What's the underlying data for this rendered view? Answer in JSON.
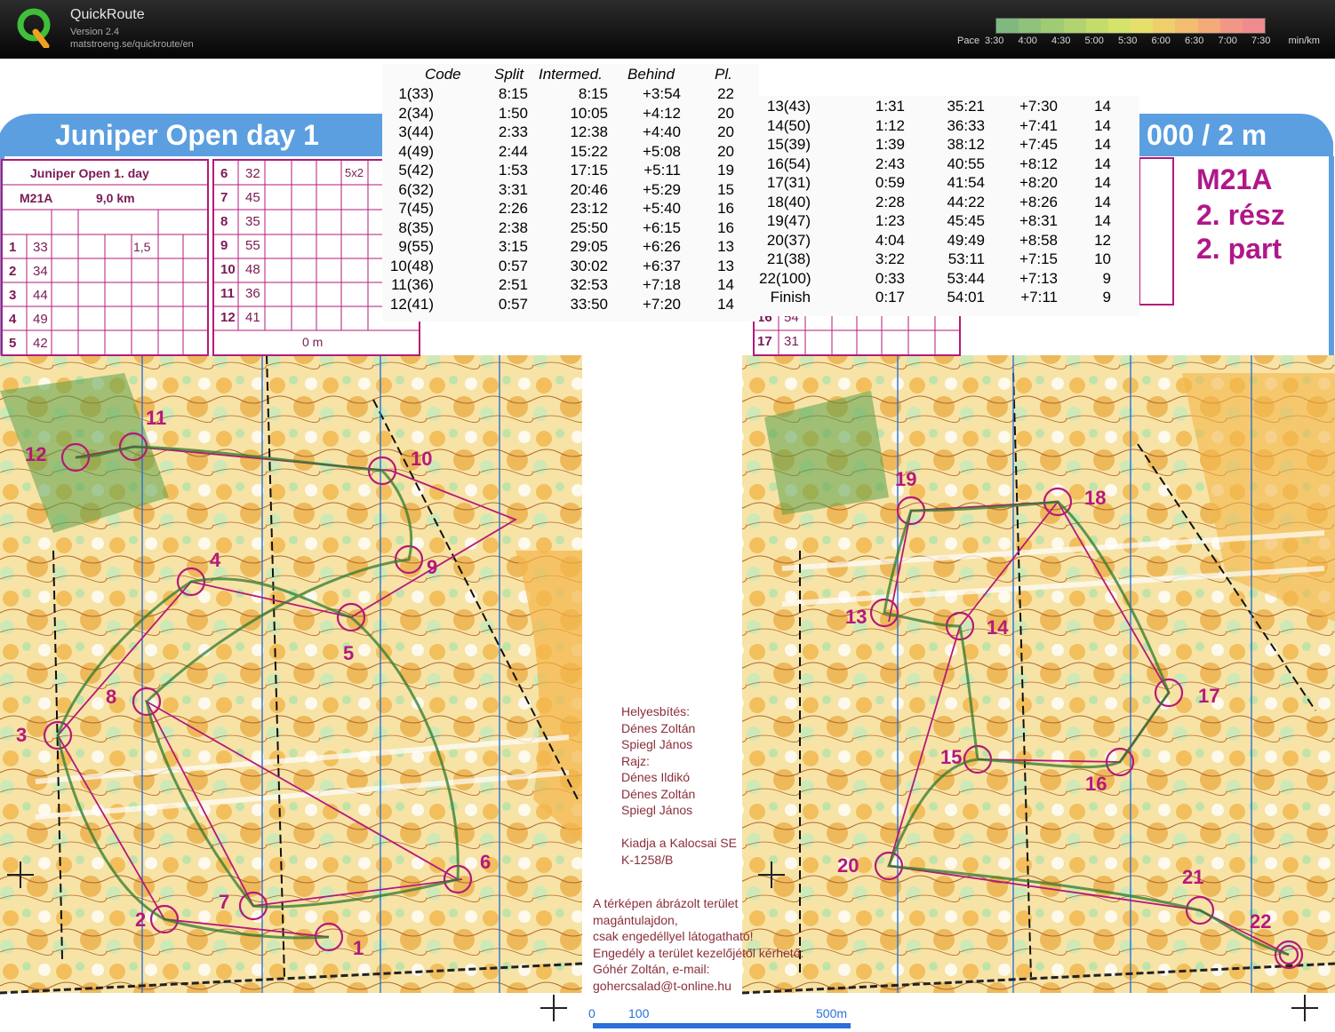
{
  "app": {
    "name": "QuickRoute",
    "version": "Version 2.4",
    "url": "matstroeng.se/quickroute/en"
  },
  "pace": {
    "label": "Pace",
    "ticks": [
      "3:30",
      "4:00",
      "4:30",
      "5:00",
      "5:30",
      "6:00",
      "6:30",
      "7:00",
      "7:30"
    ],
    "unit": "min/km",
    "colors": [
      "#7fb97f",
      "#8fc27a",
      "#9fcb75",
      "#b2d470",
      "#c4dc6c",
      "#d6e36a",
      "#e6e06a",
      "#efcf6c",
      "#f2bd70",
      "#f3a978",
      "#f29786",
      "#ef8b8f"
    ]
  },
  "map": {
    "title_left": "Juniper Open day 1",
    "title_right": "000 / 2 m",
    "course_left": {
      "event": "Juniper Open 1. day",
      "class": "M21A",
      "length": "9,0 km",
      "distance": "0 m"
    },
    "course_right": {
      "class": "M21A",
      "part_hu": "2. rész",
      "part_en": "2. part"
    },
    "left_controls": [
      {
        "n": "1",
        "code": "33",
        "extra": "1,5"
      },
      {
        "n": "2",
        "code": "34"
      },
      {
        "n": "3",
        "code": "44"
      },
      {
        "n": "4",
        "code": "49"
      },
      {
        "n": "5",
        "code": "42"
      }
    ],
    "mid_controls": [
      {
        "n": "6",
        "code": "32",
        "extra": "5x2"
      },
      {
        "n": "7",
        "code": "45"
      },
      {
        "n": "8",
        "code": "35"
      },
      {
        "n": "9",
        "code": "55"
      },
      {
        "n": "10",
        "code": "48"
      },
      {
        "n": "11",
        "code": "36"
      },
      {
        "n": "12",
        "code": "41"
      }
    ],
    "right_controls": [
      {
        "n": "16",
        "code": "54"
      },
      {
        "n": "17",
        "code": "31"
      }
    ],
    "credits": [
      "Helyesbítés:",
      "Dénes Zoltán",
      "Spiegl János",
      "Rajz:",
      "Dénes Ildikó",
      "Dénes Zoltán",
      "Spiegl János",
      "",
      "Kiadja a Kalocsai SE",
      "K-1258/B"
    ],
    "notice": [
      "A térképen ábrázolt terület",
      "magántulajdon,",
      "csak engedéllyel látogatható!",
      "Engedély a terület kezelőjétől kérhető:",
      "Góhér Zoltán, e-mail:",
      "gohercsalad@t-online.hu"
    ],
    "scale": [
      "0",
      "100",
      "500m"
    ],
    "left_labels": [
      "1",
      "2",
      "3",
      "4",
      "5",
      "6",
      "7",
      "8",
      "9",
      "10",
      "11",
      "12"
    ],
    "right_labels": [
      "13",
      "14",
      "15",
      "16",
      "17",
      "18",
      "19",
      "20",
      "21",
      "22"
    ]
  },
  "splits": {
    "headers": [
      "Code",
      "Split",
      "Intermed.",
      "Behind",
      "Pl."
    ],
    "rows": [
      [
        "1(33)",
        "8:15",
        "8:15",
        "+3:54",
        "22"
      ],
      [
        "2(34)",
        "1:50",
        "10:05",
        "+4:12",
        "20"
      ],
      [
        "3(44)",
        "2:33",
        "12:38",
        "+4:40",
        "20"
      ],
      [
        "4(49)",
        "2:44",
        "15:22",
        "+5:08",
        "20"
      ],
      [
        "5(42)",
        "1:53",
        "17:15",
        "+5:11",
        "19"
      ],
      [
        "6(32)",
        "3:31",
        "20:46",
        "+5:29",
        "15"
      ],
      [
        "7(45)",
        "2:26",
        "23:12",
        "+5:40",
        "16"
      ],
      [
        "8(35)",
        "2:38",
        "25:50",
        "+6:15",
        "16"
      ],
      [
        "9(55)",
        "3:15",
        "29:05",
        "+6:26",
        "13"
      ],
      [
        "10(48)",
        "0:57",
        "30:02",
        "+6:37",
        "13"
      ],
      [
        "11(36)",
        "2:51",
        "32:53",
        "+7:18",
        "14"
      ],
      [
        "12(41)",
        "0:57",
        "33:50",
        "+7:20",
        "14"
      ]
    ],
    "rows2": [
      [
        "13(43)",
        "1:31",
        "35:21",
        "+7:30",
        "14"
      ],
      [
        "14(50)",
        "1:12",
        "36:33",
        "+7:41",
        "14"
      ],
      [
        "15(39)",
        "1:39",
        "38:12",
        "+7:45",
        "14"
      ],
      [
        "16(54)",
        "2:43",
        "40:55",
        "+8:12",
        "14"
      ],
      [
        "17(31)",
        "0:59",
        "41:54",
        "+8:20",
        "14"
      ],
      [
        "18(40)",
        "2:28",
        "44:22",
        "+8:26",
        "14"
      ],
      [
        "19(47)",
        "1:23",
        "45:45",
        "+8:31",
        "14"
      ],
      [
        "20(37)",
        "4:04",
        "49:49",
        "+8:58",
        "12"
      ],
      [
        "21(38)",
        "3:22",
        "53:11",
        "+7:15",
        "10"
      ],
      [
        "22(100)",
        "0:33",
        "53:44",
        "+7:13",
        "9"
      ],
      [
        "Finish",
        "0:17",
        "54:01",
        "+7:11",
        "9"
      ]
    ]
  }
}
